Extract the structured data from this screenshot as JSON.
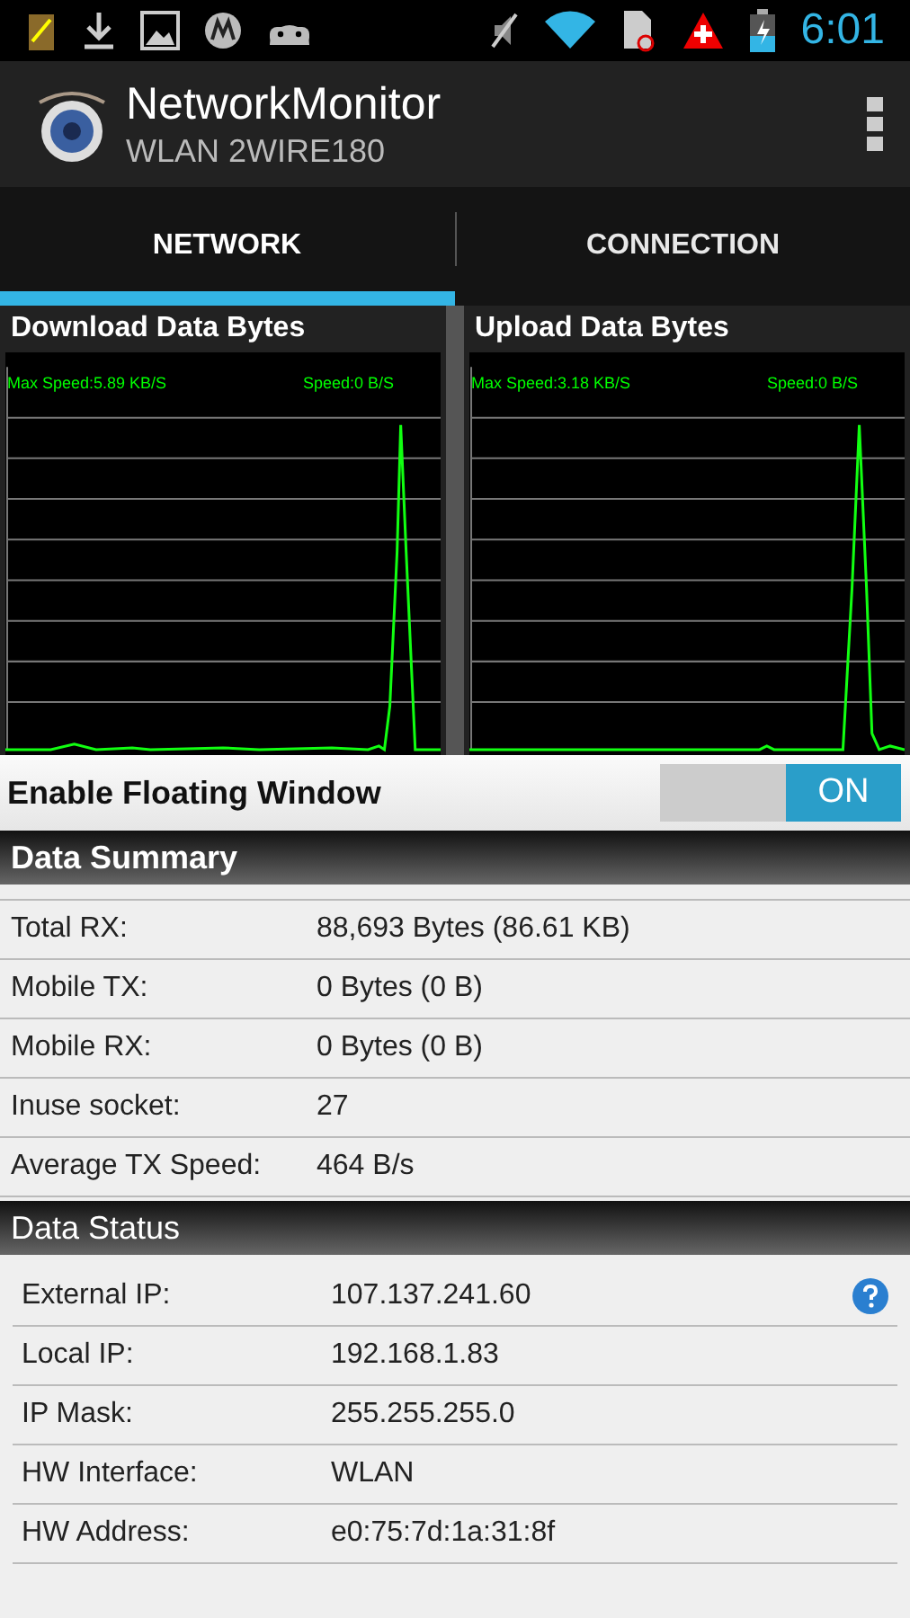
{
  "status_bar": {
    "time": "6:01"
  },
  "app_bar": {
    "title": "NetworkMonitor",
    "subtitle": "WLAN 2WIRE180"
  },
  "tabs": [
    {
      "label": "NETWORK",
      "selected": true
    },
    {
      "label": "CONNECTION",
      "selected": false
    }
  ],
  "graphs": [
    {
      "title": "Download Data Bytes",
      "max_speed": "Max Speed:5.89 KB/S",
      "speed": "Speed:0 B/S"
    },
    {
      "title": "Upload Data Bytes",
      "max_speed": "Max Speed:3.18 KB/S",
      "speed": "Speed:0 B/S"
    }
  ],
  "floating_window": {
    "label": "Enable Floating Window",
    "toggle": "ON",
    "on": true
  },
  "data_summary": {
    "title": "Data Summary",
    "rows": [
      {
        "label": "Total RX:",
        "value": "88,693 Bytes (86.61 KB)"
      },
      {
        "label": "Mobile TX:",
        "value": "0 Bytes (0 B)"
      },
      {
        "label": "Mobile RX:",
        "value": "0 Bytes (0 B)"
      },
      {
        "label": "Inuse socket:",
        "value": "27"
      },
      {
        "label": "Average TX Speed:",
        "value": "464 B/s"
      }
    ]
  },
  "data_status": {
    "title": "Data Status",
    "rows": [
      {
        "label": "External IP:",
        "value": "107.137.241.60",
        "help": true
      },
      {
        "label": "Local IP:",
        "value": "192.168.1.83"
      },
      {
        "label": "IP Mask:",
        "value": "255.255.255.0"
      },
      {
        "label": "HW Interface:",
        "value": "WLAN"
      },
      {
        "label": "HW Address:",
        "value": "e0:75:7d:1a:31:8f"
      }
    ]
  }
}
